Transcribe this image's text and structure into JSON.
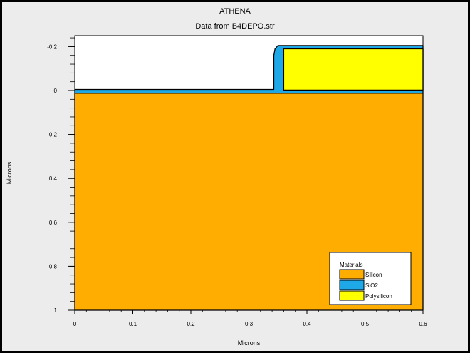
{
  "header": {
    "title": "ATHENA",
    "subtitle": "Data from B4DEPO.str"
  },
  "chart_data": {
    "type": "area",
    "title": "ATHENA",
    "subtitle": "Data from B4DEPO.str",
    "xlabel": "Microns",
    "ylabel": "Microns",
    "xlim": [
      0,
      0.6
    ],
    "ylim": [
      -0.25,
      1
    ],
    "y_inverted": true,
    "x_ticks": [
      "0",
      "0.1",
      "0.2",
      "0.3",
      "0.4",
      "0.5",
      "0.6"
    ],
    "y_ticks": [
      "-0.2",
      "0",
      "0.2",
      "0.4",
      "0.6",
      "0.8",
      "1"
    ],
    "legend": {
      "title": "Materials",
      "position": "bottom-right",
      "entries": [
        "Silicon",
        "SiO2",
        "Polysilicon"
      ]
    },
    "colors": {
      "Silicon": "#ffad00",
      "SiO2": "#1ea8e8",
      "Polysilicon": "#ffff00",
      "outline": "#000000"
    },
    "regions": [
      {
        "material": "Silicon",
        "polygon": [
          [
            0,
            0.012
          ],
          [
            0.6,
            0.012
          ],
          [
            0.6,
            1
          ],
          [
            0,
            1
          ]
        ]
      },
      {
        "material": "SiO2",
        "polygon": [
          [
            0,
            -0.005
          ],
          [
            0.343,
            -0.005
          ],
          [
            0.343,
            -0.16
          ],
          [
            0.345,
            -0.19
          ],
          [
            0.35,
            -0.205
          ],
          [
            0.6,
            -0.205
          ],
          [
            0.6,
            0.012
          ],
          [
            0,
            0.012
          ]
        ]
      },
      {
        "material": "Polysilicon",
        "polygon": [
          [
            0.36,
            -0.19
          ],
          [
            0.6,
            -0.19
          ],
          [
            0.6,
            -0.002
          ],
          [
            0.36,
            -0.002
          ]
        ]
      }
    ]
  }
}
